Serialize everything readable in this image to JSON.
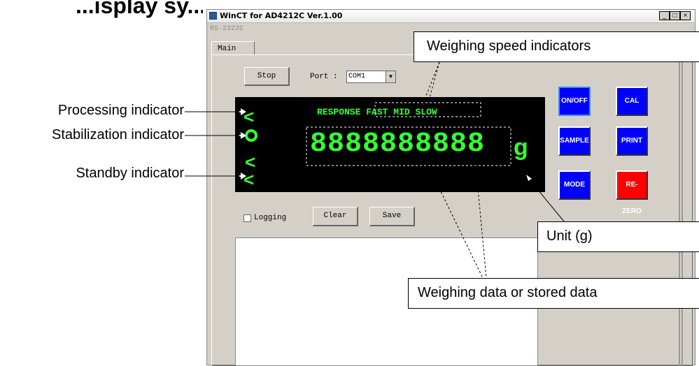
{
  "heading": {
    "partial_text": "...isplay sy..."
  },
  "window": {
    "title": "WinCT for AD4212C Ver.1.00",
    "menu_text": "RS-2322C",
    "controls": {
      "minimize": "_",
      "maximize": "□",
      "close": "×"
    },
    "tab_label": "Main",
    "stop_button": "Stop",
    "port_label": "Port :",
    "port_value": "COM1",
    "display": {
      "response_label": "RESPONSE",
      "fast": "FAST",
      "mid": "MID",
      "slow": "SLOW",
      "weight_digits": "8888888888",
      "unit": "g",
      "indicator_symbols": {
        "processing": "<",
        "standby": "<",
        "mid": "<"
      }
    },
    "keys": {
      "onoff": "ON/OFF",
      "cal": "CAL",
      "sample": "SAMPLE",
      "print": "PRINT",
      "mode": "MODE",
      "rezero": "RE-ZERO"
    },
    "logging_label": "Logging",
    "clear_button": "Clear",
    "save_button": "Save"
  },
  "annotations": {
    "processing": "Processing  indicator",
    "stabilization": "Stabilization  indicator",
    "standby": "Standby  indicator",
    "speed": "Weighing speed indicators",
    "unit": "Unit (g)",
    "data": "Weighing data or stored data"
  },
  "colors": {
    "display_bg": "#000000",
    "display_fg": "#33ff33",
    "key_blue": "#0000ff",
    "key_red": "#ff0000",
    "window_bg": "#d4d0c8"
  }
}
